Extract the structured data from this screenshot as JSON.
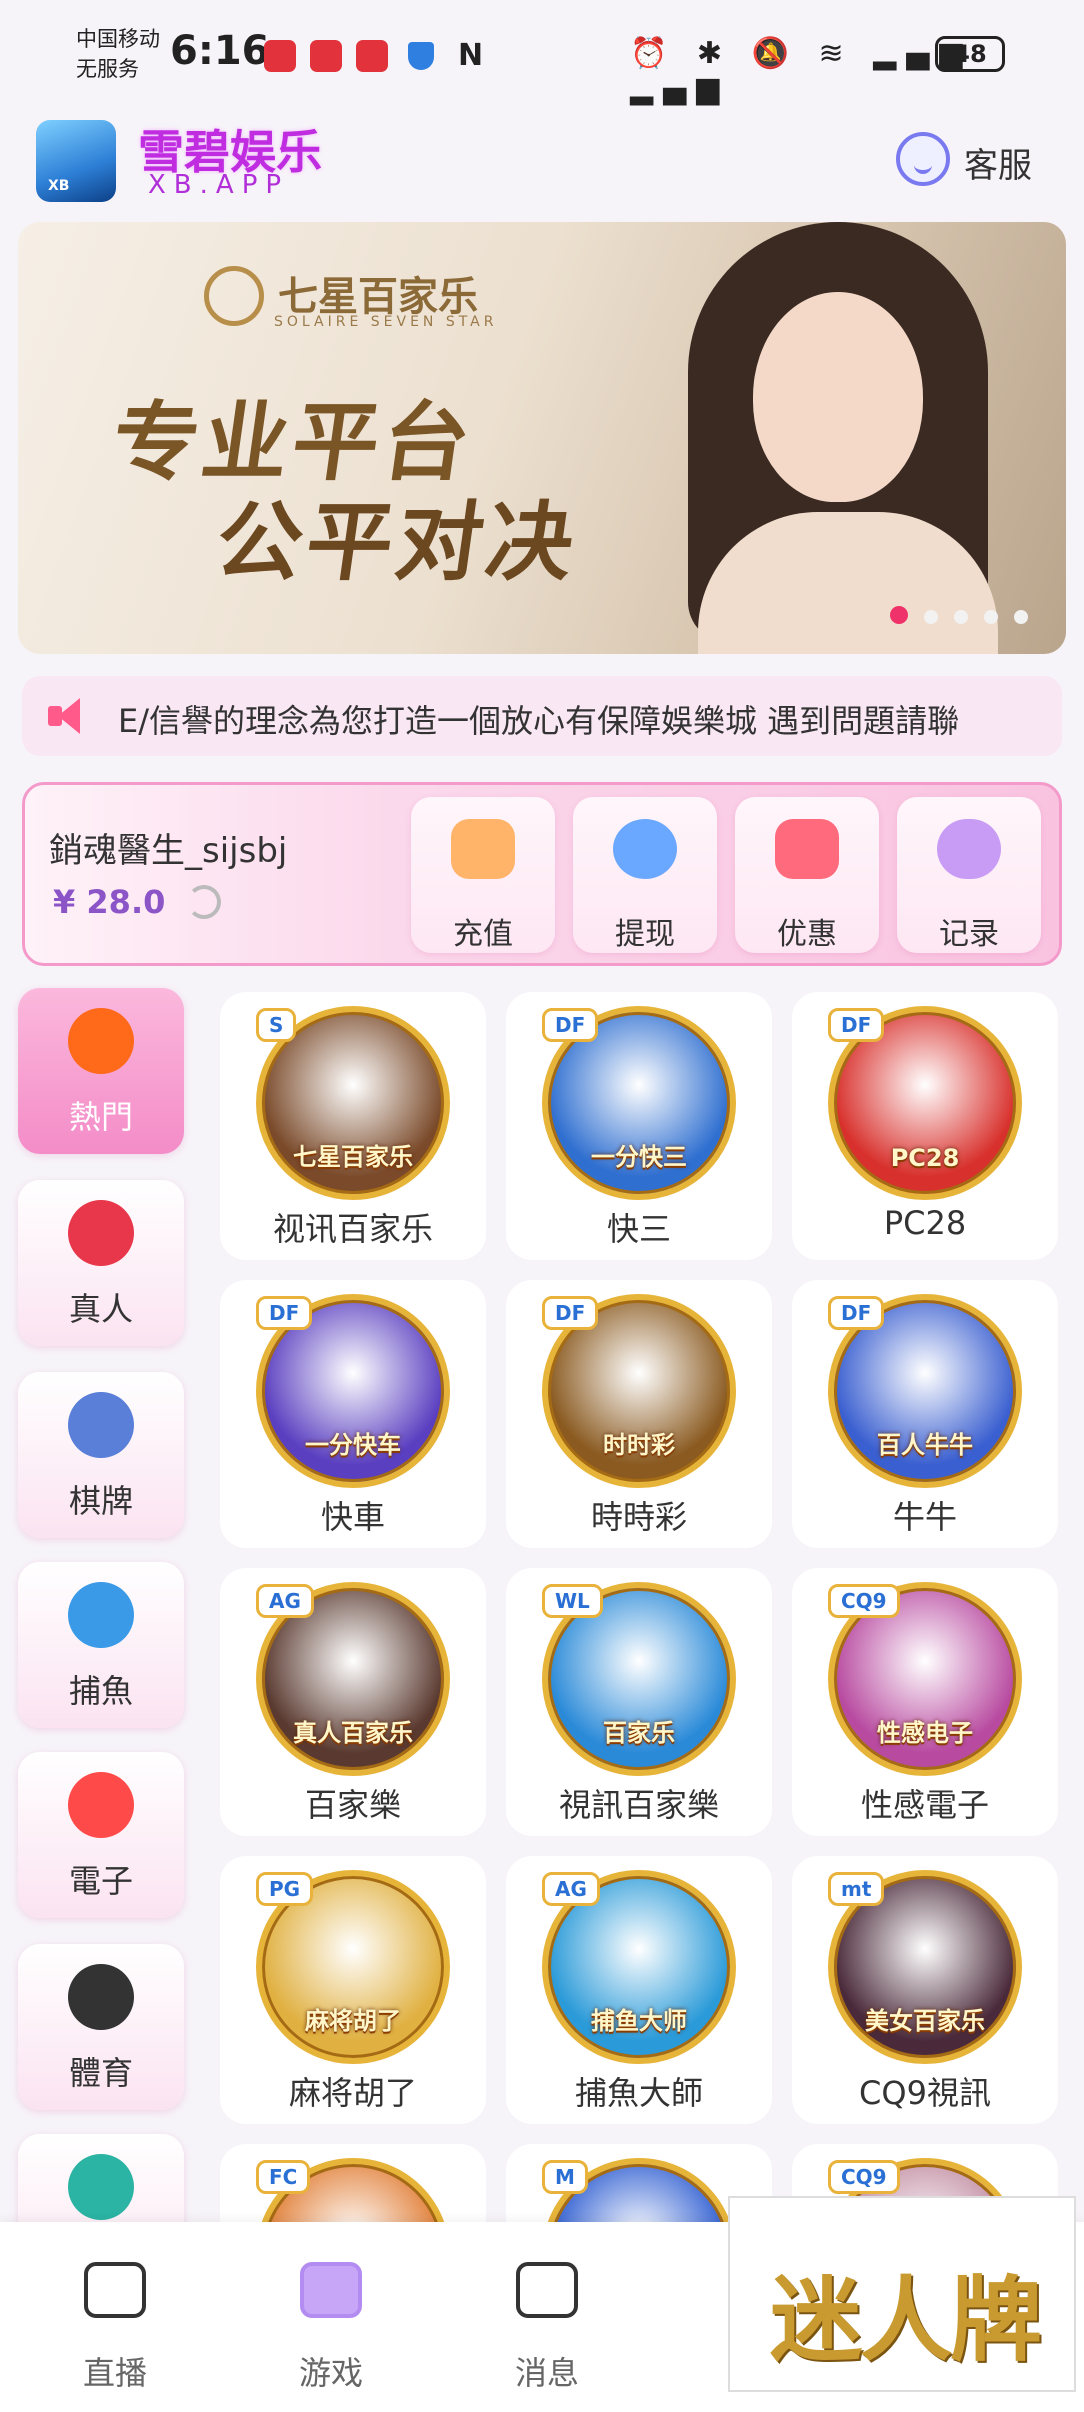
{
  "status_bar": {
    "carrier_line1": "中国移动",
    "carrier_line2": "无服务",
    "time": "6:16",
    "nfc_label": "N",
    "battery": "48",
    "icons": [
      "alarm-icon",
      "bluetooth-icon",
      "mute-icon",
      "wifi-icon",
      "4g-signal-icon",
      "no-signal-icon"
    ]
  },
  "header": {
    "app_title": "雪碧娱乐",
    "app_subtitle": "XB.APP",
    "logo_text": "XB",
    "service_label": "客服"
  },
  "banner": {
    "brand": "七星百家乐",
    "brand_sub": "SOLAIRE SEVEN STAR",
    "headline_1": "专业平台",
    "headline_2": "公平对决",
    "slide_count": 5,
    "active_slide": 1
  },
  "marquee": {
    "text": "E/信譽的理念為您打造一個放心有保障娛樂城  遇到問題請聯"
  },
  "user": {
    "username": "銷魂醫生_sijsbj",
    "balance": "¥ 28.0"
  },
  "actions": [
    {
      "label": "充值",
      "icon": "wallet-icon",
      "color": "#ffb46a"
    },
    {
      "label": "提现",
      "icon": "yen-coin-icon",
      "color": "#6aa8ff"
    },
    {
      "label": "优惠",
      "icon": "ticket-icon",
      "color": "#ff6b7d"
    },
    {
      "label": "记录",
      "icon": "gamepad-icon",
      "color": "#c89cf5"
    }
  ],
  "categories": [
    {
      "label": "熱門",
      "icon": "flame-icon",
      "color": "#ff6a1a",
      "active": true
    },
    {
      "label": "真人",
      "icon": "poker-chip-icon",
      "color": "#e8374b",
      "active": false
    },
    {
      "label": "棋牌",
      "icon": "playing-cards-icon",
      "color": "#5a7fd8",
      "active": false
    },
    {
      "label": "捕魚",
      "icon": "shark-icon",
      "color": "#3a9ae8",
      "active": false
    },
    {
      "label": "電子",
      "icon": "slot-777-icon",
      "color": "#ff4a4a",
      "active": false
    },
    {
      "label": "體育",
      "icon": "soccer-ball-icon",
      "color": "#333333",
      "active": false
    },
    {
      "label": "",
      "icon": "lottery-ball-icon",
      "color": "#2bb3a3",
      "active": false
    }
  ],
  "games": [
    {
      "label": "视讯百家乐",
      "art_text": "七星百家乐",
      "badge": "S",
      "bg": "#7a4a2a"
    },
    {
      "label": "快三",
      "art_text": "一分快三",
      "badge": "DF",
      "bg": "#2f6fd0"
    },
    {
      "label": "PC28",
      "art_text": "PC28",
      "badge": "DF",
      "bg": "#d8302c"
    },
    {
      "label": "快車",
      "art_text": "一分快车",
      "badge": "DF",
      "bg": "#5a3fc0"
    },
    {
      "label": "時時彩",
      "art_text": "时时彩",
      "badge": "DF",
      "bg": "#8a5a20"
    },
    {
      "label": "牛牛",
      "art_text": "百人牛牛",
      "badge": "DF",
      "bg": "#3a5fd0"
    },
    {
      "label": "百家樂",
      "art_text": "真人百家乐",
      "badge": "AG",
      "bg": "#5a3a30"
    },
    {
      "label": "視訊百家樂",
      "art_text": "百家乐",
      "badge": "WL",
      "bg": "#2a8ad8"
    },
    {
      "label": "性感電子",
      "art_text": "性感电子",
      "badge": "CQ9",
      "bg": "#b84aa0"
    },
    {
      "label": "麻将胡了",
      "art_text": "麻将胡了",
      "badge": "PG",
      "bg": "#e0b040"
    },
    {
      "label": "捕魚大師",
      "art_text": "捕鱼大师",
      "badge": "AG",
      "bg": "#2a9ad8"
    },
    {
      "label": "CQ9視訊",
      "art_text": "美女百家乐",
      "badge": "mt",
      "bg": "#4a2a3a"
    },
    {
      "label": "",
      "art_text": "",
      "badge": "FC",
      "bg": "#e07a30"
    },
    {
      "label": "",
      "art_text": "",
      "badge": "M",
      "bg": "#2a5ad0"
    },
    {
      "label": "",
      "art_text": "",
      "badge": "CQ9",
      "bg": "#c08aa0"
    }
  ],
  "bottom_nav": [
    {
      "label": "直播",
      "icon": "video-camera-icon",
      "active": false
    },
    {
      "label": "游戏",
      "icon": "gamepad-icon",
      "active": true
    },
    {
      "label": "消息",
      "icon": "message-icon",
      "active": false
    }
  ],
  "watermark": "迷人牌"
}
